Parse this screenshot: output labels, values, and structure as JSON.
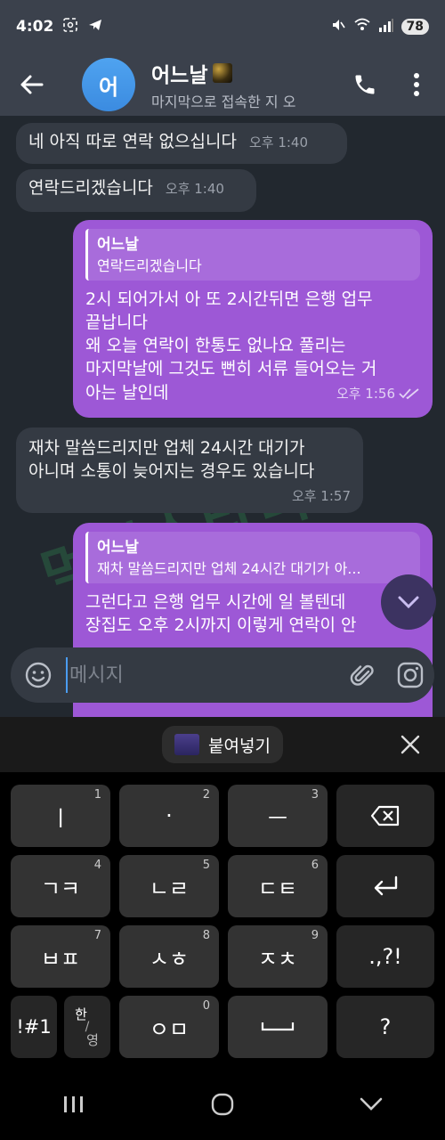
{
  "status_bar": {
    "time": "4:02",
    "battery": "78"
  },
  "header": {
    "avatar_letter": "어",
    "name": "어느날",
    "status": "마지막으로 접속한 지 오"
  },
  "watermark": "먹튀스타디",
  "messages": [
    {
      "text": "네 아직 따로 연락 없으십니다",
      "time": "오후 1:40"
    },
    {
      "text": "연락드리겠습니다",
      "time": "오후 1:40"
    },
    {
      "reply_name": "어느날",
      "reply_text": "연락드리겠습니다",
      "lines": [
        "2시 되어가서 아 또 2시간뒤면 은행 업무",
        "끝납니다",
        "왜 오늘 연락이 한통도 없나요 풀리는",
        "마지막날에 그것도 뻔히 서류 들어오는 거",
        "아는 날인데"
      ],
      "time": "오후 1:56"
    },
    {
      "lines": [
        "재차 말씀드리지만 업체 24시간 대기가",
        "아니며 소통이 늦어지는 경우도 있습니다"
      ],
      "time": "오후 1:57"
    },
    {
      "reply_name": "어느날",
      "reply_text": "재차 말씀드리지만 업체 24시간 대기가 아...",
      "lines": [
        "그런다고 은행 업무 시간에 일 볼텐데",
        "장집도 오후 2시까지 이렇게 연락이 안"
      ]
    }
  ],
  "input": {
    "placeholder": "메시지"
  },
  "keyboard_toolbar": {
    "paste_label": "붙여넣기"
  },
  "keys": {
    "k1": {
      "label": "ㅣ",
      "num": "1"
    },
    "k2": {
      "label": "·",
      "num": "2"
    },
    "k3": {
      "label": "ㅡ",
      "num": "3"
    },
    "k4": {
      "label": "ㄱㅋ",
      "num": "4"
    },
    "k5": {
      "label": "ㄴㄹ",
      "num": "5"
    },
    "k6": {
      "label": "ㄷㅌ",
      "num": "6"
    },
    "k7": {
      "label": "ㅂㅍ",
      "num": "7"
    },
    "k8": {
      "label": "ㅅㅎ",
      "num": "8"
    },
    "k9": {
      "label": "ㅈㅊ",
      "num": "9"
    },
    "k0": {
      "label": "ㅇㅁ",
      "num": "0"
    },
    "punct": ".,?!",
    "symbols": "!#1",
    "lang_top": "한",
    "lang_bottom": "영",
    "space": "␣",
    "question": "?"
  },
  "colors": {
    "chat_bg": "#22282f",
    "header_bg": "#3b414c",
    "incoming_bubble": "#343a43",
    "outgoing_bubble": "#9d58d6"
  }
}
